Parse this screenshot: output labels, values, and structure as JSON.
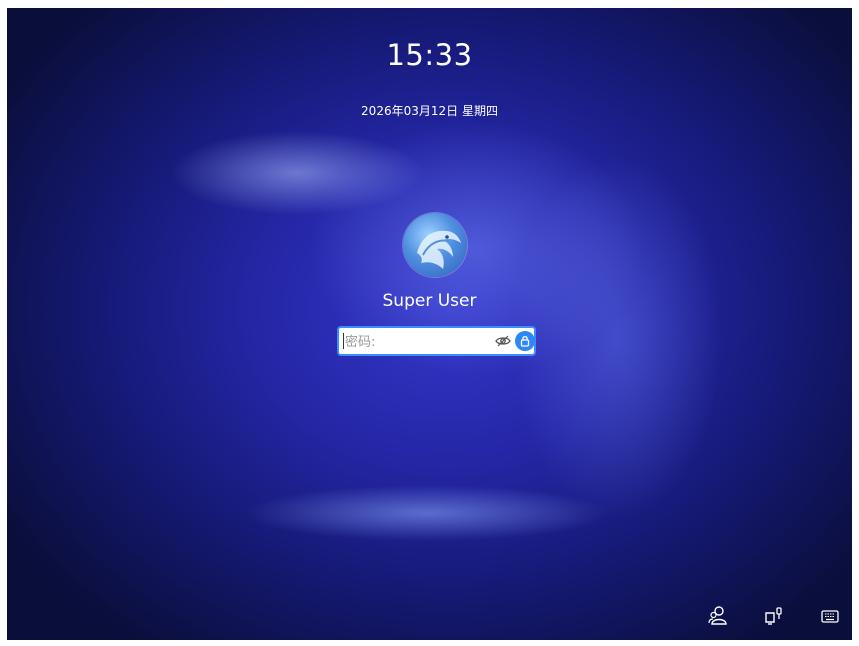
{
  "lockscreen": {
    "time": "15:33",
    "date": "2026年03月12日 星期四",
    "user_name": "Super User",
    "password": {
      "value": "",
      "placeholder": "密码:"
    }
  },
  "icons": {
    "avatar": "dragon-avatar",
    "show_password": "eye-icon",
    "unlock": "unlock-icon",
    "switch_user": "users-icon",
    "power": "power-icon",
    "keyboard": "keyboard-icon"
  },
  "colors": {
    "accent": "#2f86f5",
    "focus_border": "#3a8dff",
    "text": "#ffffff"
  }
}
